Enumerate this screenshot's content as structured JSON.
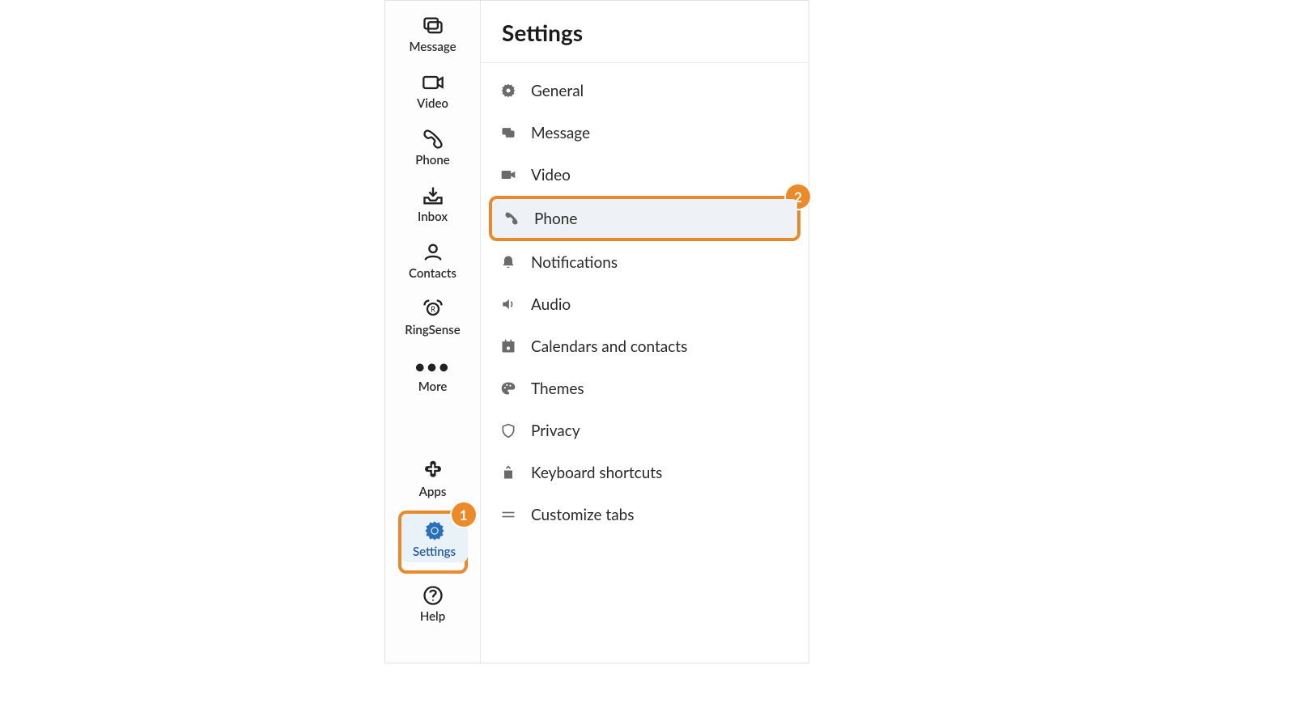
{
  "colors": {
    "callout_border": "#e88a2c",
    "callout_badge_bg": "#ed8a28",
    "active_blue": "#2a6fbd",
    "selected_row_bg": "#eef2f6"
  },
  "callouts": {
    "rail_settings": "1",
    "panel_phone": "2"
  },
  "rail": {
    "top": [
      {
        "id": "message",
        "label": "Message",
        "icon": "message-icon"
      },
      {
        "id": "video",
        "label": "Video",
        "icon": "video-icon"
      },
      {
        "id": "phone",
        "label": "Phone",
        "icon": "phone-icon"
      },
      {
        "id": "inbox",
        "label": "Inbox",
        "icon": "inbox-icon"
      },
      {
        "id": "contacts",
        "label": "Contacts",
        "icon": "contacts-icon"
      },
      {
        "id": "ringsense",
        "label": "RingSense",
        "icon": "ringsense-icon"
      },
      {
        "id": "more",
        "label": "More",
        "icon": "more-icon"
      }
    ],
    "bottom": [
      {
        "id": "apps",
        "label": "Apps",
        "icon": "apps-icon"
      },
      {
        "id": "settings",
        "label": "Settings",
        "icon": "settings-icon",
        "active": true,
        "callout": "1"
      },
      {
        "id": "help",
        "label": "Help",
        "icon": "help-icon"
      }
    ]
  },
  "panel": {
    "title": "Settings",
    "items": [
      {
        "id": "general",
        "label": "General",
        "icon": "gear-icon"
      },
      {
        "id": "message",
        "label": "Message",
        "icon": "message-solid-icon"
      },
      {
        "id": "video",
        "label": "Video",
        "icon": "video-solid-icon"
      },
      {
        "id": "phone",
        "label": "Phone",
        "icon": "phone-solid-icon",
        "selected": true,
        "callout": "2"
      },
      {
        "id": "notifications",
        "label": "Notifications",
        "icon": "bell-icon"
      },
      {
        "id": "audio",
        "label": "Audio",
        "icon": "speaker-icon"
      },
      {
        "id": "calendar",
        "label": "Calendars and contacts",
        "icon": "calendar-icon"
      },
      {
        "id": "themes",
        "label": "Themes",
        "icon": "palette-icon"
      },
      {
        "id": "privacy",
        "label": "Privacy",
        "icon": "shield-icon"
      },
      {
        "id": "keyboard",
        "label": "Keyboard shortcuts",
        "icon": "keyboard-icon"
      },
      {
        "id": "customize",
        "label": "Customize tabs",
        "icon": "lines-icon"
      }
    ]
  }
}
